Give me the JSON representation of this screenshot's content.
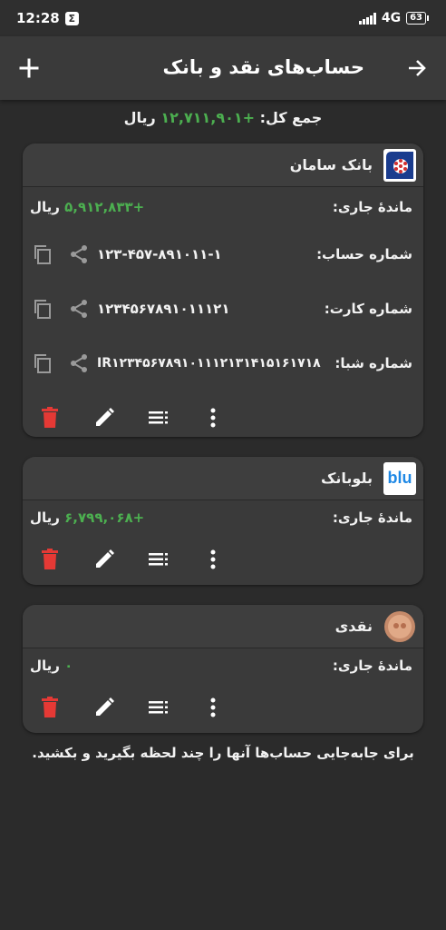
{
  "status_bar": {
    "time": "12:28",
    "network": "4G",
    "battery": "63"
  },
  "header": {
    "title": "حساب‌های نقد و بانک",
    "back_icon": "arrow-right-icon",
    "add_icon": "plus-icon"
  },
  "total": {
    "label": "جمع کل:",
    "value": "+۱۲,۷۱۱,۹۰۱",
    "unit": "ریال"
  },
  "accounts": [
    {
      "name": "بانک سامان",
      "logo": "saman-bank-logo",
      "balance_label": "ماندهٔ جاری:",
      "balance_value": "+۵,۹۱۲,۸۳۳",
      "unit": "ریال",
      "account_number_label": "شماره حساب:",
      "account_number": "۱۲۳-۴۵۷-۸۹۱۰۱۱-۱",
      "card_number_label": "شماره کارت:",
      "card_number": "۱۲۳۴۵۶۷۸۹۱۰۱۱۱۲۱",
      "sheba_label": "شماره شبا:",
      "sheba": "IR۱۲۳۴۵۶۷۸۹۱۰۱۱۱۲۱۳۱۴۱۵۱۶۱۷۱۸"
    },
    {
      "name": "بلوبانک",
      "logo_text": "blu",
      "balance_label": "ماندهٔ جاری:",
      "balance_value": "+۶,۷۹۹,۰۶۸",
      "unit": "ریال"
    },
    {
      "name": "نقدی",
      "logo": "coin-logo",
      "balance_label": "ماندهٔ جاری:",
      "balance_value": "۰",
      "unit": "ریال"
    }
  ],
  "hint": "برای جابه‌جایی حساب‌ها آنها را چند لحظه بگیرید و بکشید.",
  "colors": {
    "positive": "#4caf50",
    "delete": "#e53935",
    "background": "#2b2b2b",
    "card": "#3a3a3a"
  }
}
